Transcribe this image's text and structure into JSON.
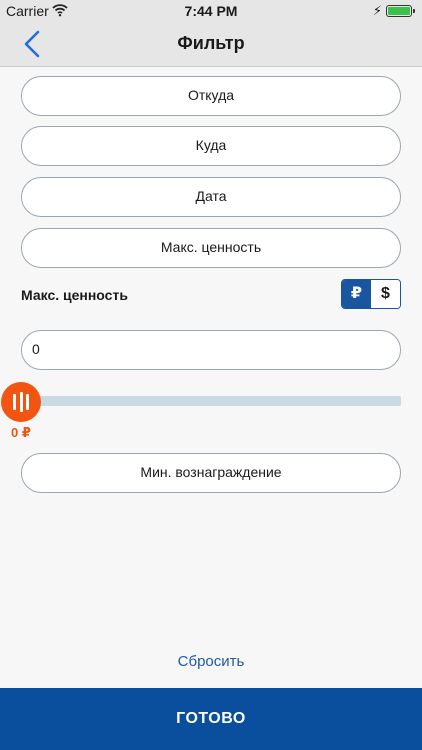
{
  "status_bar": {
    "carrier": "Carrier",
    "time": "7:44 PM"
  },
  "nav": {
    "title": "Фильтр",
    "back_icon": "chevron-left-icon"
  },
  "fields": {
    "from_label": "Откуда",
    "to_label": "Куда",
    "date_label": "Дата",
    "max_value_label": "Макс. ценность",
    "min_reward_label": "Мин. вознаграждение"
  },
  "max_value_section": {
    "label": "Макс. ценность",
    "currency_options": [
      "₽",
      "$"
    ],
    "selected_currency": "₽",
    "input_value": "0"
  },
  "slider": {
    "value": 0,
    "value_label": "0 ₽"
  },
  "actions": {
    "reset_label": "Сбросить",
    "done_label": "ГОТОВО"
  },
  "colors": {
    "accent": "#0a4f9e",
    "slider_thumb": "#f25412",
    "track": "#c8dbe2"
  }
}
